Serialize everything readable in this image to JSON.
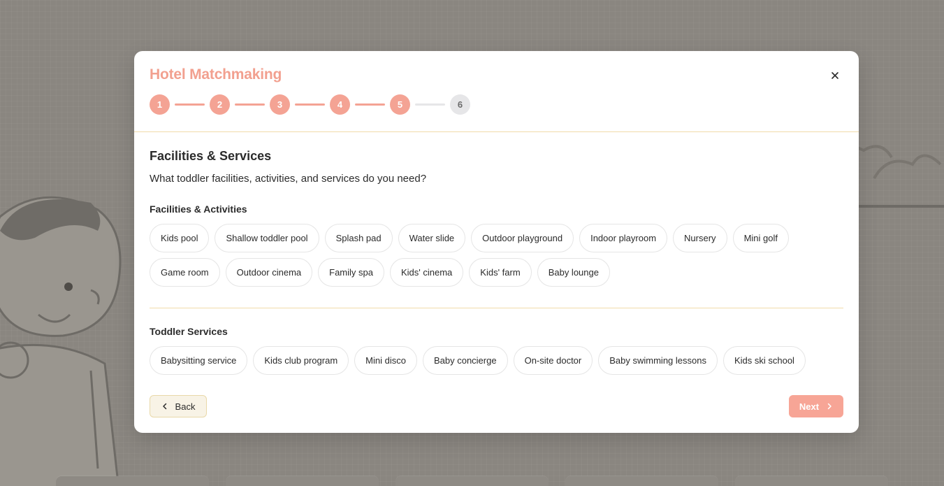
{
  "modal": {
    "title": "Hotel Matchmaking",
    "close_icon": "close-icon",
    "steps": [
      {
        "label": "1",
        "state": "complete"
      },
      {
        "label": "2",
        "state": "complete"
      },
      {
        "label": "3",
        "state": "complete"
      },
      {
        "label": "4",
        "state": "complete"
      },
      {
        "label": "5",
        "state": "current"
      },
      {
        "label": "6",
        "state": "pending"
      }
    ],
    "section": {
      "title": "Facilities & Services",
      "description": "What toddler facilities, activities, and services do you need?"
    },
    "facilities": {
      "title": "Facilities & Activities",
      "options": [
        "Kids pool",
        "Shallow toddler pool",
        "Splash pad",
        "Water slide",
        "Outdoor playground",
        "Indoor playroom",
        "Nursery",
        "Mini golf",
        "Game room",
        "Outdoor cinema",
        "Family spa",
        "Kids' cinema",
        "Kids' farm",
        "Baby lounge"
      ]
    },
    "services": {
      "title": "Toddler Services",
      "options": [
        "Babysitting service",
        "Kids club program",
        "Mini disco",
        "Baby concierge",
        "On-site doctor",
        "Baby swimming lessons",
        "Kids ski school"
      ]
    },
    "footer": {
      "back_label": "Back",
      "next_label": "Next"
    }
  },
  "colors": {
    "accent": "#f4a394",
    "divider": "#f0dcaa",
    "back_bg": "#f8f3e6",
    "pending_step": "#e6e6e8"
  }
}
